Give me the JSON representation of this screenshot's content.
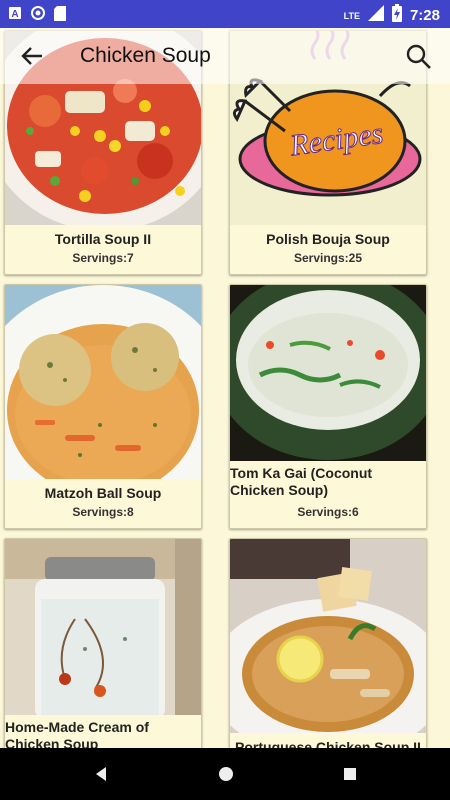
{
  "status_bar": {
    "time": "7:28",
    "network": "LTE",
    "icons": [
      "notification-a-icon",
      "sync-icon",
      "sd-card-icon",
      "signal-icon",
      "battery-charging-icon"
    ]
  },
  "toolbar": {
    "title": "Chicken Soup",
    "back_icon": "arrow-back-icon",
    "search_icon": "search-icon"
  },
  "recipes": [
    {
      "name": "Tortilla Soup II",
      "servings": "Servings:7",
      "image": "tortilla-soup-photo"
    },
    {
      "name": "Polish Bouja Soup",
      "servings": "Servings:25",
      "image": "recipes-chicken-logo",
      "logo_text": "Recipes"
    },
    {
      "name": "Matzoh Ball Soup",
      "servings": "Servings:8",
      "image": "matzoh-ball-photo"
    },
    {
      "name": "Tom Ka Gai (Coconut Chicken Soup)",
      "servings": "Servings:6",
      "image": "tom-ka-gai-photo"
    },
    {
      "name": "Home-Made Cream of Chicken Soup",
      "servings": "",
      "image": "cream-jar-photo"
    },
    {
      "name": "Portuguese Chicken Soup II",
      "servings": "",
      "image": "portuguese-soup-photo"
    }
  ],
  "nav_bar": {
    "icons": [
      "back-triangle-icon",
      "home-circle-icon",
      "recents-square-icon"
    ]
  },
  "colors": {
    "status_bar": "#3f44c9",
    "background": "#fbf7d8",
    "accent": "#e98a1a"
  }
}
